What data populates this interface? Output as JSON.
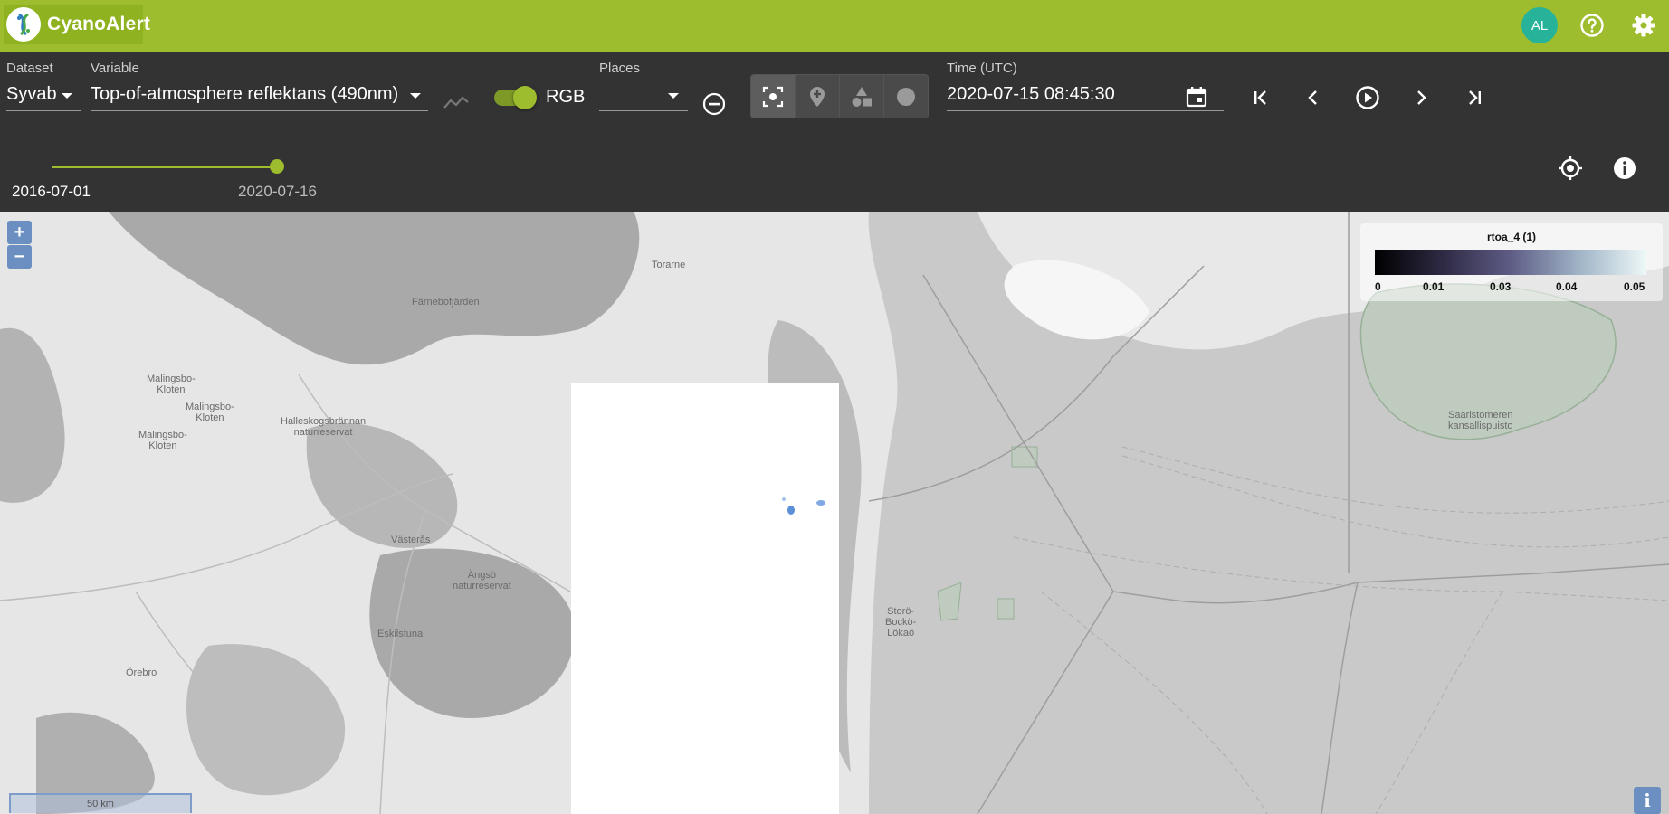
{
  "app": {
    "title": "CyanoAlert",
    "user_initials": "AL"
  },
  "icons": {
    "help": "help-circle-icon",
    "settings": "gear-icon",
    "chart": "timeseries-chart-icon",
    "remove_place": "minus-circle-icon",
    "calendar": "calendar-icon",
    "locate": "crosshair-icon",
    "info": "info-icon"
  },
  "controls": {
    "dataset": {
      "label": "Dataset",
      "value": "Syvab"
    },
    "variable": {
      "label": "Variable",
      "value": "Top-of-atmosphere reflektans (490nm)"
    },
    "rgb": {
      "label": "RGB",
      "enabled": true
    },
    "places": {
      "label": "Places",
      "value": ""
    },
    "time": {
      "label": "Time (UTC)",
      "value": "2020-07-15 08:45:30"
    },
    "time_range": {
      "start": "2016-07-01",
      "end": "2020-07-16",
      "position": 1.0
    }
  },
  "map": {
    "zoom_in": "+",
    "zoom_out": "−",
    "legend": {
      "title": "rtoa_4 (1)",
      "ticks": [
        "0",
        "0.01",
        "0.03",
        "0.04",
        "0.05"
      ]
    },
    "places": [
      {
        "name": "Färnebofjärden"
      },
      {
        "name": "Torarne"
      },
      {
        "name": "Malingsbo-\nKloten"
      },
      {
        "name": "Malingsbo-\nKloten"
      },
      {
        "name": "Malingsbo-\nKloten"
      },
      {
        "name": "Halleskogsbrännan\nnaturreservat"
      },
      {
        "name": "Västerås"
      },
      {
        "name": "Ängsö\nnaturreservat"
      },
      {
        "name": "Eskilstuna"
      },
      {
        "name": "Örebro"
      },
      {
        "name": "Storö-\nBockö-\nLökaö"
      },
      {
        "name": "Saaristomeren\nkansallispuisto"
      }
    ],
    "scale": "50 km",
    "attribution": "i"
  },
  "colors": {
    "accent": "#9ebd2e",
    "toolbar": "#333333",
    "avatar": "#26b39a"
  }
}
